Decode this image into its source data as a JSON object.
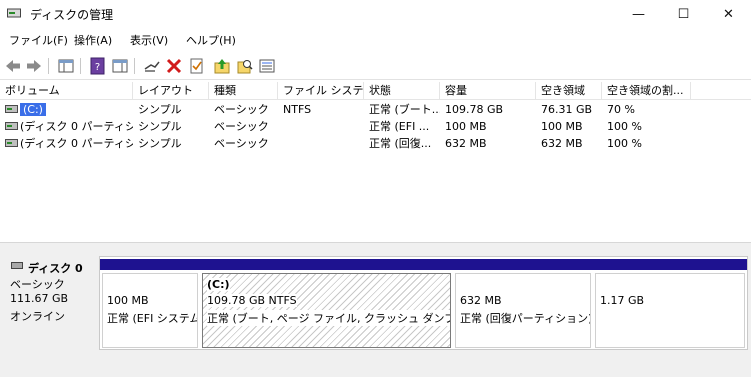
{
  "window": {
    "title": "ディスクの管理",
    "minimize_glyph": "—",
    "maximize_glyph": "☐",
    "close_glyph": "✕"
  },
  "menu": [
    "ファイル(F)",
    "操作(A)",
    "表示(V)",
    "ヘルプ(H)"
  ],
  "toolbar": {
    "buttons": [
      "back-icon",
      "forward-icon",
      "console-tree-icon",
      "help-icon",
      "properties-panel-icon",
      "connect-icon",
      "delete-icon",
      "check-icon",
      "up-icon",
      "search-icon",
      "list-icon"
    ]
  },
  "volumes": {
    "columns": [
      "ボリューム",
      "レイアウト",
      "種類",
      "ファイル システム",
      "状態",
      "容量",
      "空き領域",
      "空き領域の割..."
    ],
    "rows": [
      [
        "(C:)",
        "シンプル",
        "ベーシック",
        "NTFS",
        "正常 (ブート...",
        "109.78 GB",
        "76.31 GB",
        "70 %"
      ],
      [
        "(ディスク 0 パーティシ...",
        "シンプル",
        "ベーシック",
        "",
        "正常 (EFI ...",
        "100 MB",
        "100 MB",
        "100 %"
      ],
      [
        "(ディスク 0 パーティシ...",
        "シンプル",
        "ベーシック",
        "",
        "正常 (回復...",
        "632 MB",
        "632 MB",
        "100 %"
      ]
    ]
  },
  "disk": {
    "name": "ディスク 0",
    "type": "ベーシック",
    "size": "111.67 GB",
    "status": "オンライン",
    "partitions": [
      {
        "title": "",
        "size": "100 MB",
        "status": "正常 (EFI システム"
      },
      {
        "title": "(C:)",
        "size": "109.78 GB NTFS",
        "status": "正常 (ブート, ページ ファイル, クラッシュ ダンプ, ベーシ"
      },
      {
        "title": "",
        "size": "632 MB",
        "status": "正常 (回復パーティション)"
      },
      {
        "title": "",
        "size": "1.17 GB",
        "status": ""
      }
    ]
  },
  "colors": {
    "partition_bar": "#1e1290",
    "selection": "#3a6ee8"
  }
}
